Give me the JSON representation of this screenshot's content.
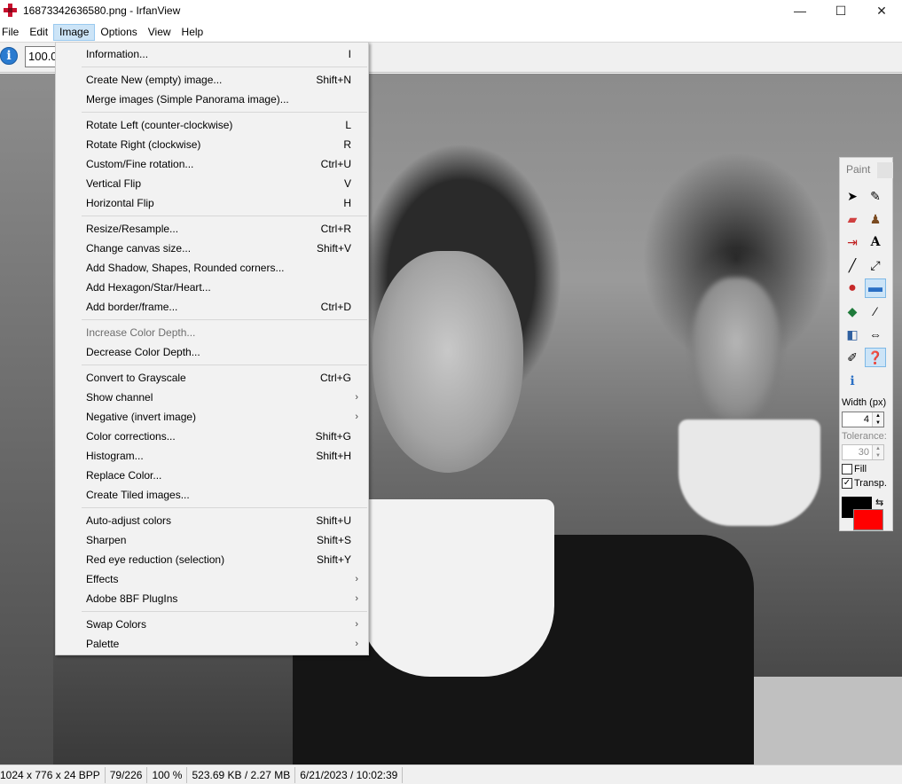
{
  "window": {
    "title": "16873342636580.png - IrfanView",
    "minimize": "—",
    "maximize": "☐",
    "close": "✕"
  },
  "menubar": [
    "File",
    "Edit",
    "Image",
    "Options",
    "View",
    "Help"
  ],
  "toolbar": {
    "zoom_value": "100.0"
  },
  "image_menu": {
    "items": [
      {
        "label": "Information...",
        "shortcut": "I"
      },
      {
        "label": "Create New (empty) image...",
        "shortcut": "Shift+N"
      },
      {
        "label": "Merge images (Simple Panorama image)...",
        "shortcut": ""
      },
      {
        "label": "Rotate Left (counter-clockwise)",
        "shortcut": "L"
      },
      {
        "label": "Rotate Right (clockwise)",
        "shortcut": "R"
      },
      {
        "label": "Custom/Fine rotation...",
        "shortcut": "Ctrl+U"
      },
      {
        "label": "Vertical Flip",
        "shortcut": "V"
      },
      {
        "label": "Horizontal Flip",
        "shortcut": "H"
      },
      {
        "label": "Resize/Resample...",
        "shortcut": "Ctrl+R"
      },
      {
        "label": "Change canvas size...",
        "shortcut": "Shift+V"
      },
      {
        "label": "Add Shadow, Shapes, Rounded corners...",
        "shortcut": ""
      },
      {
        "label": "Add Hexagon/Star/Heart...",
        "shortcut": ""
      },
      {
        "label": "Add border/frame...",
        "shortcut": "Ctrl+D"
      },
      {
        "label": "Increase Color Depth...",
        "shortcut": ""
      },
      {
        "label": "Decrease Color Depth...",
        "shortcut": ""
      },
      {
        "label": "Convert to Grayscale",
        "shortcut": "Ctrl+G"
      },
      {
        "label": "Show channel",
        "shortcut": ""
      },
      {
        "label": "Negative (invert image)",
        "shortcut": ""
      },
      {
        "label": "Color corrections...",
        "shortcut": "Shift+G"
      },
      {
        "label": "Histogram...",
        "shortcut": "Shift+H"
      },
      {
        "label": "Replace Color...",
        "shortcut": ""
      },
      {
        "label": "Create Tiled images...",
        "shortcut": ""
      },
      {
        "label": "Auto-adjust colors",
        "shortcut": "Shift+U"
      },
      {
        "label": "Sharpen",
        "shortcut": "Shift+S"
      },
      {
        "label": "Red eye reduction (selection)",
        "shortcut": "Shift+Y"
      },
      {
        "label": "Effects",
        "shortcut": ""
      },
      {
        "label": "Adobe 8BF PlugIns",
        "shortcut": ""
      },
      {
        "label": "Swap Colors",
        "shortcut": ""
      },
      {
        "label": "Palette",
        "shortcut": ""
      }
    ]
  },
  "paint": {
    "title": "Paint",
    "width_label": "Width (px)",
    "width_value": "4",
    "tolerance_label": "Tolerance:",
    "tolerance_value": "30",
    "fill_label": "Fill",
    "transp_label": "Transp.",
    "foreground_color": "#000000",
    "background_color": "#ff0000"
  },
  "statusbar": {
    "dimensions": "1024 x 776 x 24 BPP",
    "index": "79/226",
    "zoom": "100 %",
    "size": "523.69 KB / 2.27 MB",
    "datetime": "6/21/2023 / 10:02:39"
  }
}
